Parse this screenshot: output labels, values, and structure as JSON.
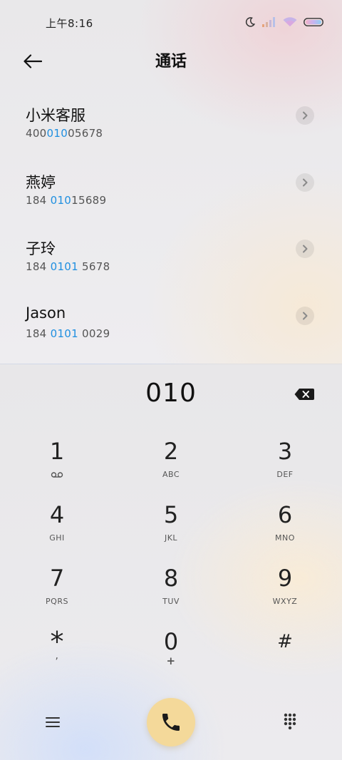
{
  "status_bar": {
    "time": "上午8:16",
    "icons": [
      "moon-icon",
      "signal-icon",
      "wifi-icon",
      "battery-icon"
    ]
  },
  "header": {
    "title": "通话",
    "back_icon": "back-arrow-icon"
  },
  "query": "010",
  "contacts": [
    {
      "name": "小米客服",
      "number_pre": "400",
      "number_hl": "010",
      "number_post": "05678"
    },
    {
      "name": "燕婷",
      "number_pre": "184 ",
      "number_hl": "010",
      "number_post": "15689"
    },
    {
      "name": "子玲",
      "number_pre": "184 ",
      "number_hl": "0101",
      "number_post": " 5678"
    },
    {
      "name": "Jason",
      "number_pre": "184 ",
      "number_hl": "0101",
      "number_post": " 0029"
    }
  ],
  "dialer": {
    "input": "010",
    "keys": [
      {
        "digit": "1",
        "sub": "",
        "icon": "voicemail-icon"
      },
      {
        "digit": "2",
        "sub": "ABC"
      },
      {
        "digit": "3",
        "sub": "DEF"
      },
      {
        "digit": "4",
        "sub": "GHI"
      },
      {
        "digit": "5",
        "sub": "JKL"
      },
      {
        "digit": "6",
        "sub": "MNO"
      },
      {
        "digit": "7",
        "sub": "PQRS"
      },
      {
        "digit": "8",
        "sub": "TUV"
      },
      {
        "digit": "9",
        "sub": "WXYZ"
      },
      {
        "digit": "*",
        "sub": ","
      },
      {
        "digit": "0",
        "sub": "+"
      },
      {
        "digit": "#",
        "sub": ""
      }
    ],
    "bottom_icons": [
      "menu-icon",
      "phone-icon",
      "dialpad-icon"
    ]
  },
  "colors": {
    "highlight": "#1f8fe0",
    "call_button": "#f4d99a"
  }
}
